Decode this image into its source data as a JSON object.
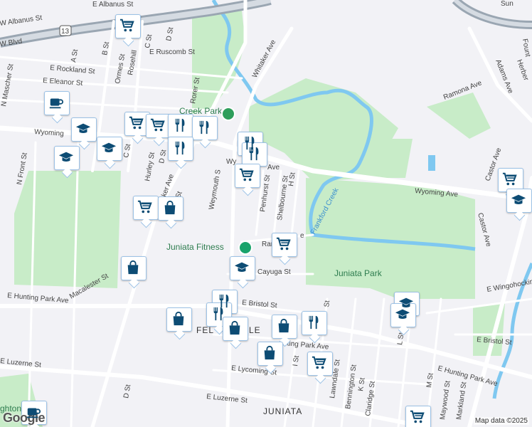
{
  "map": {
    "attribution": "Map data ©2025",
    "logo": "Google",
    "colors": {
      "background": "#f2f2f6",
      "park": "#c8ecc8",
      "water": "#7fc8f0",
      "road": "#ffffff",
      "highway": "#9aa6b2",
      "marker_icon": "#0d4c74"
    },
    "streets": {
      "e_albanus": "E Albanus St",
      "w_albanus": "W Albanus St",
      "blvd": "W Blvd",
      "route13": "13",
      "e_ruscomb": "E Ruscomb St",
      "e_rockland": "E Rockland St",
      "e_eleanor": "E Eleanor St",
      "w_wyoming": "Wyoming",
      "wyoming_ave": "Wyoming Ave",
      "wyoming_mid": "Wy",
      "wyoming_mid2": "Ave",
      "n_front": "N Front St",
      "n_mascher": "N Mascher St",
      "hurley": "Hurley St",
      "d_st": "D St",
      "c_st": "C St",
      "b_st": "B St",
      "a_st": "A St",
      "ormes": "Ormes St",
      "rosehill": "Rosehill",
      "rorer": "Rorer St",
      "whitaker_ave": "Whitaker Ave",
      "whitaker_low": "taker Ave",
      "rampa": "mpa St",
      "weymouth": "Weymouth S",
      "penhurst": "Penhurst St",
      "shelbourne": "Shelbourne St",
      "h_st": "H St",
      "randolph": "Ran",
      "randolph2": "e",
      "cayuga": "Cayuga St",
      "macalester": "Macalester St",
      "e_hunting_park": "E Hunting Park Ave",
      "e_hunting_park2": "E Hunting Park Ave",
      "hunting_park_mid": "nting Park Ave",
      "e_bristol": "E Bristol St",
      "e_bristol2": "E Bristol St",
      "e_luzerne": "E Luzerne St",
      "e_luzerne2": "E Luzerne St",
      "e_lycoming": "E Lycoming St",
      "feltonville_a": "FEL",
      "feltonville_b": "LE",
      "juniata": "JUNIATA",
      "lawndale": "Lawndale St",
      "bennington": "Bennington St",
      "k_st": "K St",
      "claridge": "Claridge St",
      "l_st": "L St",
      "m_st": "M St",
      "maywood": "Maywood St",
      "markland": "Markland St",
      "i_st": "I St",
      "g_st": "St",
      "castor": "Castor Ave",
      "castor2": "Castor Ave",
      "adams": "Adams Ave",
      "ramona": "Ramona Ave",
      "herbert": "Herber",
      "fountain": "Fount",
      "e_wingohocking": "E Wingohocking",
      "d_st_south": "D St",
      "sun": "Sun"
    },
    "parks": {
      "tacony_creek": "Creek Park",
      "juniata_park": "Juniata Park",
      "frankford_creek": "Frankford Creek",
      "juniata_fitness": "Juniata Fitness",
      "bottom_left": "ghton"
    },
    "markers": [
      {
        "type": "grocery",
        "icon": "cart-icon"
      },
      {
        "type": "cafe",
        "icon": "coffee-icon"
      },
      {
        "type": "school",
        "icon": "school-icon"
      },
      {
        "type": "school",
        "icon": "school-icon"
      },
      {
        "type": "school",
        "icon": "school-icon"
      },
      {
        "type": "grocery",
        "icon": "cart-icon"
      },
      {
        "type": "grocery",
        "icon": "cart-icon"
      },
      {
        "type": "restaurant",
        "icon": "restaurant-icon"
      },
      {
        "type": "restaurant",
        "icon": "restaurant-icon"
      },
      {
        "type": "restaurant",
        "icon": "restaurant-icon"
      },
      {
        "type": "restaurant",
        "icon": "restaurant-icon"
      },
      {
        "type": "restaurant",
        "icon": "restaurant-icon"
      },
      {
        "type": "grocery",
        "icon": "cart-icon"
      },
      {
        "type": "grocery",
        "icon": "cart-icon"
      },
      {
        "type": "shopping",
        "icon": "shopping-bag-icon"
      },
      {
        "type": "grocery",
        "icon": "cart-icon"
      },
      {
        "type": "shopping",
        "icon": "shopping-bag-icon"
      },
      {
        "type": "school",
        "icon": "school-icon"
      },
      {
        "type": "restaurant",
        "icon": "restaurant-icon"
      },
      {
        "type": "restaurant",
        "icon": "restaurant-icon"
      },
      {
        "type": "shopping",
        "icon": "shopping-bag-icon"
      },
      {
        "type": "shopping",
        "icon": "shopping-bag-icon"
      },
      {
        "type": "shopping",
        "icon": "shopping-bag-icon"
      },
      {
        "type": "restaurant",
        "icon": "restaurant-icon"
      },
      {
        "type": "shopping",
        "icon": "shopping-bag-icon"
      },
      {
        "type": "grocery",
        "icon": "cart-icon"
      },
      {
        "type": "school",
        "icon": "school-icon"
      },
      {
        "type": "school",
        "icon": "school-icon"
      },
      {
        "type": "grocery",
        "icon": "cart-icon"
      },
      {
        "type": "school",
        "icon": "school-icon"
      },
      {
        "type": "grocery",
        "icon": "cart-icon"
      },
      {
        "type": "cafe",
        "icon": "coffee-icon"
      }
    ]
  }
}
